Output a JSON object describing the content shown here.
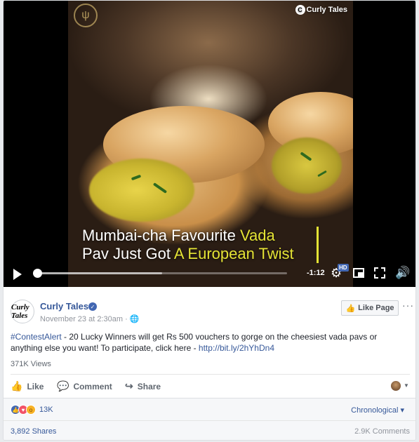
{
  "video": {
    "caption_line1_a": "Mumbai-cha Favourite ",
    "caption_line1_b": "Vada",
    "caption_line2_a": "Pav Just Got ",
    "caption_line2_b": "A European Twist",
    "brand_logo": "Curly Tales",
    "time_remaining": "-1:12",
    "hd_badge": "HD",
    "progress_fraction": 0.0,
    "buffer_fraction": 0.5
  },
  "post": {
    "avatar_text": "Curly Tales",
    "page_name": "Curly Tales",
    "timestamp": "November 23 at 2:30am · ",
    "like_page_label": "Like Page",
    "more_label": "···",
    "text_tag": "#ContestAlert",
    "text_body": " - 20 Lucky Winners will get Rs 500 vouchers to gorge on the cheesiest vada pavs or anything else you want! To participate, click here - ",
    "text_link": "http://bit.ly/2hYhDn4",
    "views": "371K Views"
  },
  "actions": {
    "like_label": "Like",
    "comment_label": "Comment",
    "share_label": "Share"
  },
  "stats": {
    "reactions_count": "13K",
    "sort_label": "Chronological ▾",
    "shares": "3,892 Shares",
    "comments": "2.9K Comments"
  },
  "colors": {
    "link_blue": "#365899",
    "caption_yellow": "#e4e335",
    "fb_blue": "#4267b2"
  }
}
